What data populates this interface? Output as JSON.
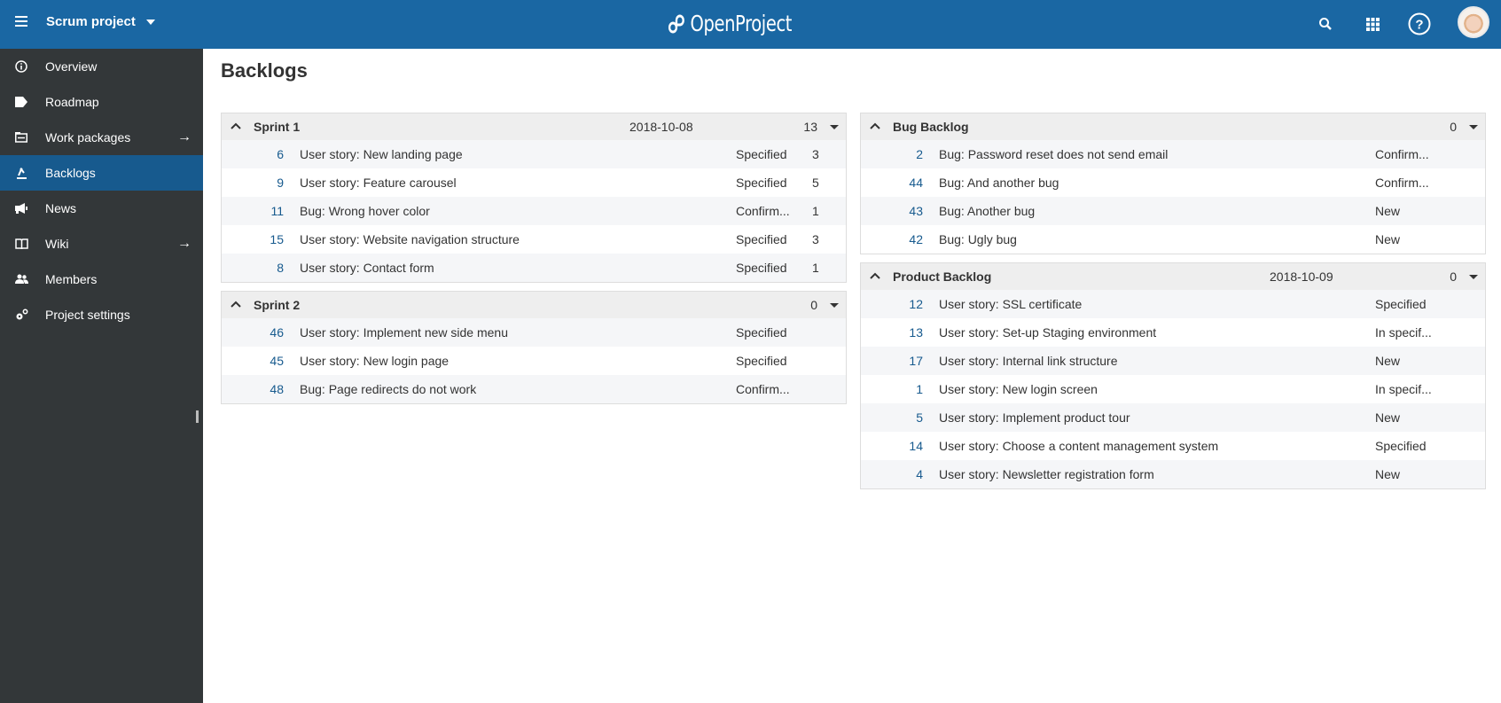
{
  "header": {
    "menu_icon": "hamburger-icon",
    "project_name": "Scrum project",
    "logo_text": "OpenProject",
    "search_icon": "search-icon",
    "modules_icon": "grid-icon",
    "help_icon": "help-icon",
    "avatar": "user-avatar"
  },
  "sidebar": {
    "items": [
      {
        "label": "Overview",
        "icon": "info-icon",
        "active": false,
        "arrow": false
      },
      {
        "label": "Roadmap",
        "icon": "tag-icon",
        "active": false,
        "arrow": false
      },
      {
        "label": "Work packages",
        "icon": "work-packages-icon",
        "active": false,
        "arrow": true
      },
      {
        "label": "Backlogs",
        "icon": "backlogs-icon",
        "active": true,
        "arrow": false
      },
      {
        "label": "News",
        "icon": "megaphone-icon",
        "active": false,
        "arrow": false
      },
      {
        "label": "Wiki",
        "icon": "book-icon",
        "active": false,
        "arrow": true
      },
      {
        "label": "Members",
        "icon": "group-icon",
        "active": false,
        "arrow": false
      },
      {
        "label": "Project settings",
        "icon": "settings-icon",
        "active": false,
        "arrow": false
      }
    ],
    "arrow_glyph": "→"
  },
  "page": {
    "title": "Backlogs"
  },
  "sprints": [
    {
      "name": "Sprint 1",
      "date": "2018-10-08",
      "velocity": "13",
      "items": [
        {
          "id": "6",
          "subject": "User story: New landing page",
          "status": "Specified",
          "points": "3"
        },
        {
          "id": "9",
          "subject": "User story: Feature carousel",
          "status": "Specified",
          "points": "5"
        },
        {
          "id": "11",
          "subject": "Bug: Wrong hover color",
          "status": "Confirm...",
          "points": "1"
        },
        {
          "id": "15",
          "subject": "User story: Website navigation structure",
          "status": "Specified",
          "points": "3"
        },
        {
          "id": "8",
          "subject": "User story: Contact form",
          "status": "Specified",
          "points": "1"
        }
      ]
    },
    {
      "name": "Sprint 2",
      "date": "",
      "velocity": "0",
      "items": [
        {
          "id": "46",
          "subject": "User story: Implement new side menu",
          "status": "Specified",
          "points": ""
        },
        {
          "id": "45",
          "subject": "User story: New login page",
          "status": "Specified",
          "points": ""
        },
        {
          "id": "48",
          "subject": "Bug: Page redirects do not work",
          "status": "Confirm...",
          "points": ""
        }
      ]
    }
  ],
  "backlogs": [
    {
      "name": "Bug Backlog",
      "date": "",
      "velocity": "0",
      "items": [
        {
          "id": "2",
          "subject": "Bug: Password reset does not send email",
          "status": "Confirm...",
          "points": ""
        },
        {
          "id": "44",
          "subject": "Bug: And another bug",
          "status": "Confirm...",
          "points": ""
        },
        {
          "id": "43",
          "subject": "Bug: Another bug",
          "status": "New",
          "points": ""
        },
        {
          "id": "42",
          "subject": "Bug: Ugly bug",
          "status": "New",
          "points": ""
        }
      ]
    },
    {
      "name": "Product Backlog",
      "date": "2018-10-09",
      "velocity": "0",
      "items": [
        {
          "id": "12",
          "subject": "User story: SSL certificate",
          "status": "Specified",
          "points": ""
        },
        {
          "id": "13",
          "subject": "User story: Set-up Staging environment",
          "status": "In specif...",
          "points": ""
        },
        {
          "id": "17",
          "subject": "User story: Internal link structure",
          "status": "New",
          "points": ""
        },
        {
          "id": "1",
          "subject": "User story: New login screen",
          "status": "In specif...",
          "points": ""
        },
        {
          "id": "5",
          "subject": "User story: Implement product tour",
          "status": "New",
          "points": ""
        },
        {
          "id": "14",
          "subject": "User story: Choose a content management system",
          "status": "Specified",
          "points": ""
        },
        {
          "id": "4",
          "subject": "User story: Newsletter registration form",
          "status": "New",
          "points": ""
        }
      ]
    }
  ],
  "colors": {
    "header_bg": "#1a67a3",
    "sidebar_bg": "#333739",
    "sidebar_active": "#175a8e",
    "id_link": "#175a8e",
    "panel_header_bg": "#eeeeee"
  }
}
